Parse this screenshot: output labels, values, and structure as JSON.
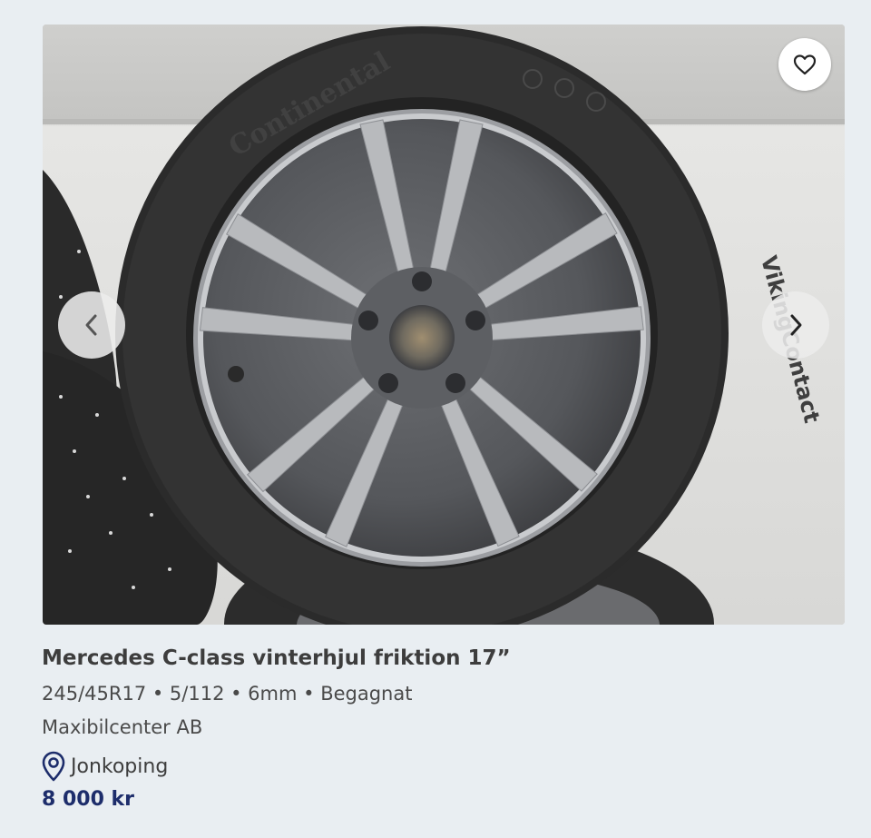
{
  "listing": {
    "title": "Mercedes C-class vinterhjul friktion 17”",
    "specs": "245/45R17 • 5/112 • 6mm • Begagnat",
    "seller": "Maxibilcenter AB",
    "location": "Jonkoping",
    "price": "8 000 kr",
    "image_brand_text": "Continental",
    "image_model_text": "VikingContact"
  },
  "icons": {
    "favorite": "heart-outline-icon",
    "prev": "chevron-left-icon",
    "next": "chevron-right-icon",
    "location": "location-pin-icon"
  },
  "colors": {
    "background": "#e9eef2",
    "title_text": "#3d3d3d",
    "price_text": "#1d2d6b",
    "location_icon": "#1d2d6b"
  }
}
